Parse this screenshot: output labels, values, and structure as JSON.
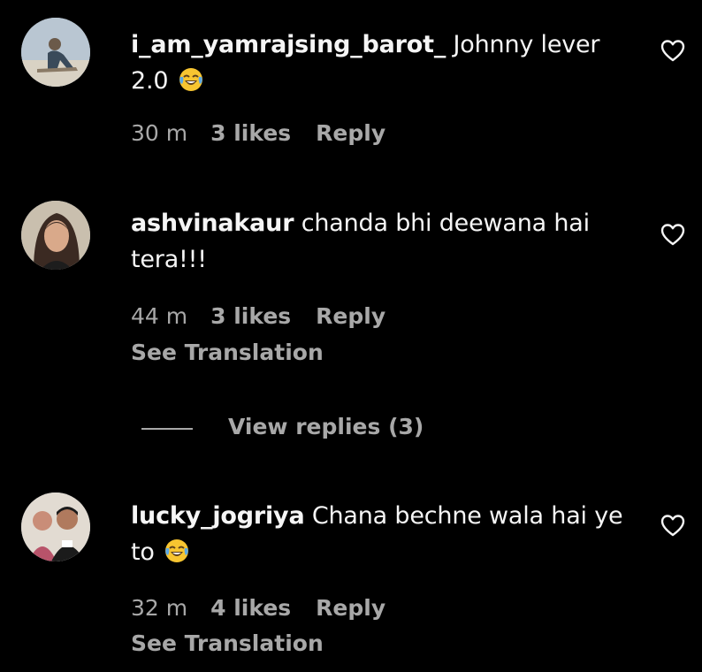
{
  "comments": [
    {
      "username": "i_am_yamrajsing_barot_",
      "text": "Johnny lever 2.0",
      "emoji": "face-with-tears-of-joy",
      "time": "30 m",
      "likes": "3 likes",
      "reply": "Reply"
    },
    {
      "username": "ashvinakaur",
      "text": "chanda bhi deewana hai tera!!!",
      "time": "44 m",
      "likes": "3 likes",
      "reply": "Reply",
      "see_translation": "See Translation"
    },
    {
      "username": "lucky_jogriya",
      "text": "Chana bechne wala hai ye to",
      "emoji": "face-with-tears-of-joy",
      "time": "32 m",
      "likes": "4 likes",
      "reply": "Reply",
      "see_translation": "See Translation"
    }
  ],
  "view_replies": "View replies (3)",
  "colors": {
    "background": "#000000",
    "primary_text": "#f5f5f5",
    "secondary_text": "#a8a8a8",
    "emoji_yellow": "#f7c531",
    "emoji_tear": "#5aa8e8"
  },
  "icons": {
    "like": "heart-outline-icon",
    "emoji": "face-with-tears-of-joy-icon"
  }
}
